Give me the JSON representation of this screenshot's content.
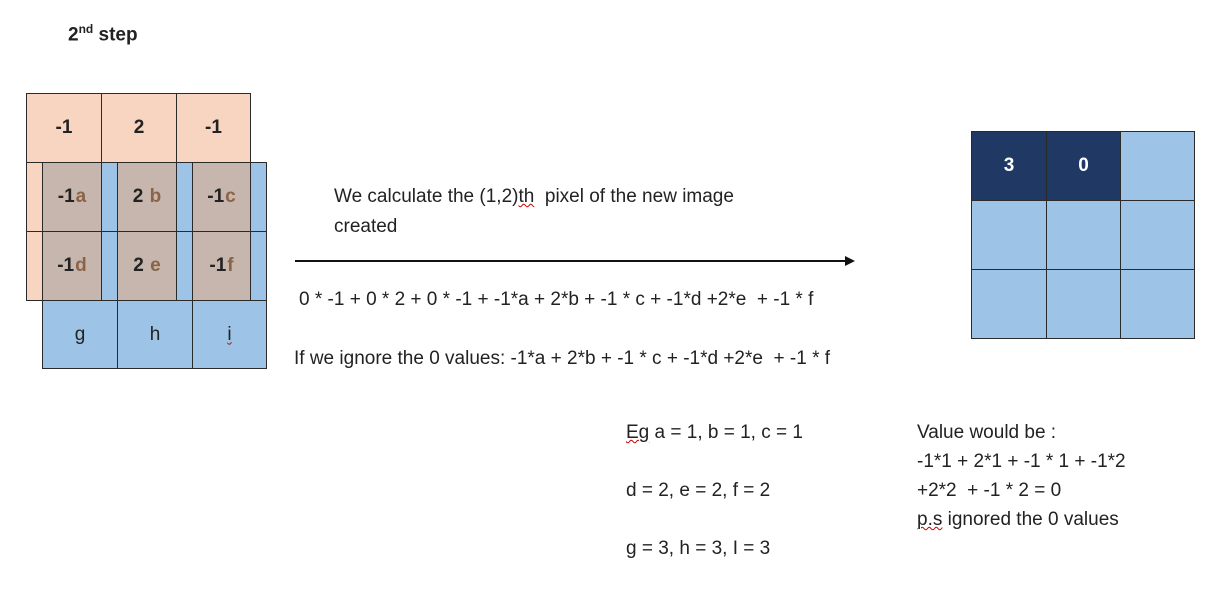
{
  "title": {
    "main": "2",
    "sup": "nd",
    "rest": " step"
  },
  "kernel_top_row": [
    "-1",
    "2",
    "-1"
  ],
  "overlap_cells": [
    {
      "num": "-1",
      "letter": "a"
    },
    {
      "num": "2",
      "letter": "b"
    },
    {
      "num": "-1",
      "letter": "c"
    },
    {
      "num": "-1",
      "letter": "d"
    },
    {
      "num": "2",
      "letter": "e"
    },
    {
      "num": "-1",
      "letter": "f"
    }
  ],
  "bottom_row": [
    "g",
    "h",
    "i"
  ],
  "description": {
    "line1_a": "We calculate the (1,2)",
    "line1_b": "th",
    "line1_c": "  pixel of the new image",
    "line2": "created"
  },
  "formula_full": "0 * -1 + 0 * 2 + 0 * -1 + -1*a + 2*b + -1 * c + -1*d +2*e  + -1 * f",
  "formula_ignored": "If we ignore the 0 values: -1*a + 2*b + -1 * c + -1*d +2*e  + -1 * f",
  "example": {
    "line1_a": "Eg",
    "line1_b": " a = 1, b = 1, c = 1",
    "line2": "d = 2, e = 2, f = 2",
    "line3": "g = 3, h = 3, I = 3"
  },
  "value": {
    "line1": "Value would be :",
    "line2": "-1*1 + 2*1 + -1 * 1 + -1*2",
    "line3": "+2*2  + -1 * 2 = 0",
    "line4_a": "p.s",
    "line4_b": " ignored the 0 values"
  },
  "output_grid": [
    "3",
    "0",
    "",
    "",
    "",
    "",
    "",
    "",
    ""
  ],
  "colors": {
    "navy": "#1f3864",
    "blue": "#9dc3e6",
    "peach": "#f8d5c0",
    "overlap": "#c7b6ad"
  }
}
